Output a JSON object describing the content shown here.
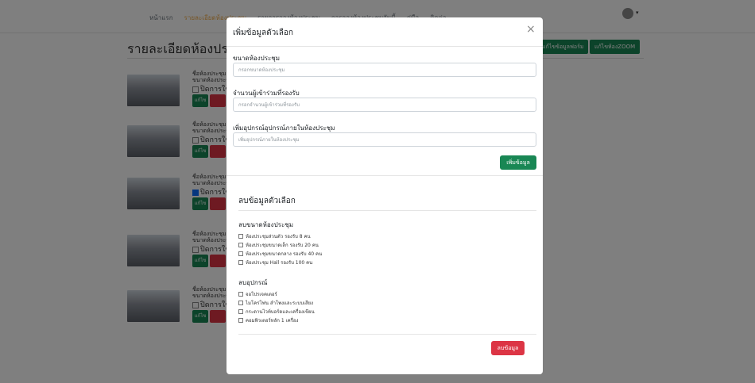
{
  "nav": {
    "items": [
      {
        "label": "หน้าแรก",
        "active": false
      },
      {
        "label": "รายละเอียดห้องประชุม",
        "active": true
      },
      {
        "label": "รายการจองห้องประชุม",
        "active": false
      },
      {
        "label": "การจองห้องประชุมวันนี้",
        "active": false
      },
      {
        "label": "คู่มือ",
        "active": false
      },
      {
        "label": "ติดต่อ",
        "active": false
      }
    ]
  },
  "page": {
    "heading": "รายละเอียดห้องประชุม",
    "btn_form": "แก้ไขข้อมูลฟอร์ม",
    "btn_zoom": "แก้ไขห้องZOOM"
  },
  "rooms": [
    {
      "name": "ชื่อห้องประชุม",
      "size": "ขนาดห้องประชุม",
      "status": "ปิดการใช้งาน",
      "checked": false,
      "edit": "แก้ไข"
    },
    {
      "name": "ชื่อห้องประชุม",
      "size": "ขนาดห้องประชุม",
      "status": "ปิดการใช้งาน",
      "checked": false,
      "edit": "แก้ไข"
    },
    {
      "name": "ชื่อห้องประชุม",
      "size": "ขนาดห้องประชุม",
      "status": "ปิดการใช้งาน",
      "checked": true,
      "edit": "แก้ไข"
    },
    {
      "name": "ชื่อห้องประชุม",
      "size": "ขนาดห้องประชุม",
      "status": "ปิดการใช้งาน",
      "checked": false,
      "edit": "แก้ไข"
    },
    {
      "name": "ชื่อห้องประชุม",
      "size": "ขนาดห้องประชุม",
      "status": "ปิดการใช้งาน",
      "checked": false,
      "edit": "แก้ไข"
    }
  ],
  "modal": {
    "title": "เพิ่มข้อมูลตัวเลือก",
    "close": "×",
    "size_label": "ขนาดห้องประชุม",
    "size_placeholder": "กรอกขนาดห้องประชุม",
    "attendees_label": "จำนวนผู้เข้าร่วมที่รองรับ",
    "attendees_placeholder": "กรอกจำนวนผู้เข้าร่วมที่รองรับ",
    "equipment_label": "เพิ่มอุปกรณ์อุปกรณ์ภายในห้องประชุม",
    "equipment_placeholder": "เพิ่มอุปกรณ์ภายในห้องประชุม",
    "add_button": "เพิ่มข้อมูล",
    "delete_section_title": "ลบข้อมูลตัวเลือก",
    "delete_size_label": "ลบขนาดห้องประชุม",
    "size_options": [
      "ห้องประชุมส่วนตัว รองรับ 8 คน",
      "ห้องประชุมขนาดเล็ก รองรับ 20 คน",
      "ห้องประชุมขนาดกลาง รองรับ 40 คน",
      "ห้องประชุม Hall รองรับ 100 คน"
    ],
    "delete_equipment_label": "ลบอุปกรณ์",
    "equipment_options": [
      "จอโปรเจคเตอร์",
      "ไมโครโฟน ลำโพงและระบบเสียง",
      "กระดานไวท์บอร์ดและเครื่องเขียน",
      "คอมพิวเตอร์หลัก 1 เครื่อง"
    ],
    "delete_button": "ลบข้อมูล"
  }
}
